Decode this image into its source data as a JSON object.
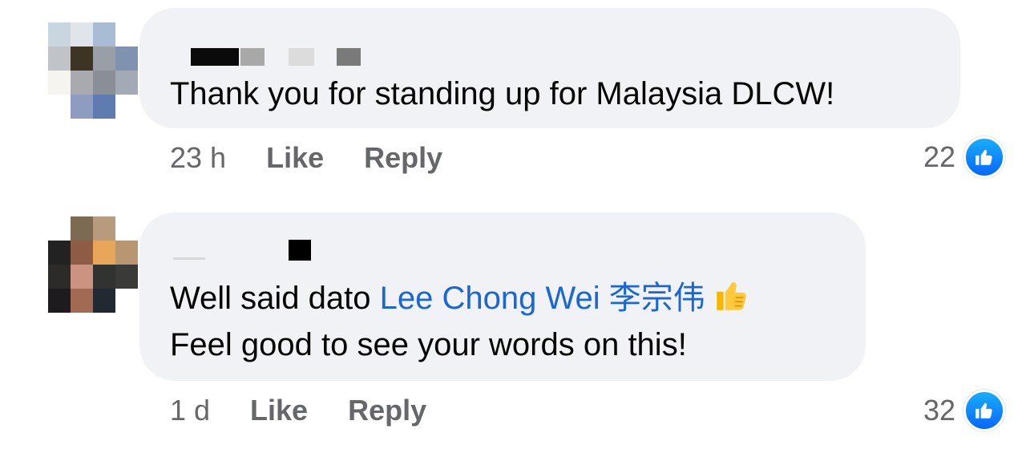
{
  "comments": [
    {
      "text_line1": "Thank you for standing up for Malaysia DLCW!",
      "time": "23 h",
      "like_label": "Like",
      "reply_label": "Reply",
      "reaction_count": "22",
      "reaction_icon": "like-icon"
    },
    {
      "text_prefix": "Well said dato ",
      "mention": "Lee Chong Wei 李宗伟",
      "emoji": "thumbs-up-icon",
      "text_line2": "Feel good to see your words on this!",
      "time": "1 d",
      "like_label": "Like",
      "reply_label": "Reply",
      "reaction_count": "32",
      "reaction_icon": "like-icon"
    }
  ],
  "colors": {
    "bubble": "#f0f2f5",
    "mention": "#1b66d2",
    "meta_text": "#65676b",
    "like_blue": "#0866ff"
  }
}
